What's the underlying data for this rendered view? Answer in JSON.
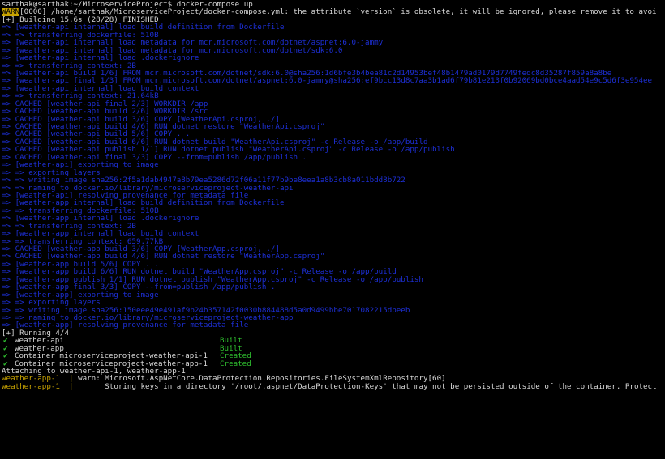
{
  "terminal": {
    "prompt": "sarthak@sarthak:~/MicroserviceProject$ docker-compose up",
    "warn": {
      "tag": "WARN",
      "text": "[0000] /home/sarthak/MicroserviceProject/docker-compose.yml: the attribute `version` is obsolete, it will be ignored, please remove it to avoi"
    },
    "building": "[+] Building 15.6s (28/28) FINISHED",
    "build_lines": [
      "=> [weather-api internal] load build definition from Dockerfile",
      "=> => transferring dockerfile: 510B",
      "=> [weather-api internal] load metadata for mcr.microsoft.com/dotnet/aspnet:6.0-jammy",
      "=> [weather-api internal] load metadata for mcr.microsoft.com/dotnet/sdk:6.0",
      "=> [weather-api internal] load .dockerignore",
      "=> => transferring context: 2B",
      "=> [weather-api build 1/6] FROM mcr.microsoft.com/dotnet/sdk:6.0@sha256:1d6bfe3b4bea81c2d14953bef48b1479ad0179d7749fedc8d35287f859a8a8be",
      "=> [weather-api final 1/3] FROM mcr.microsoft.com/dotnet/aspnet:6.0-jammy@sha256:ef9bcc13d8c7aa3b1ad6f79b81e213f0b92069bd0bce4aad54e9c5d6f3e954ee",
      "=> [weather-api internal] load build context",
      "=> => transferring context: 21.64kB",
      "=> CACHED [weather-api final 2/3] WORKDIR /app",
      "=> CACHED [weather-api build 2/6] WORKDIR /src",
      "=> CACHED [weather-api build 3/6] COPY [WeatherApi.csproj, ./]",
      "=> CACHED [weather-api build 4/6] RUN dotnet restore \"WeatherApi.csproj\"",
      "=> CACHED [weather-api build 5/6] COPY . .",
      "=> CACHED [weather-api build 6/6] RUN dotnet build \"WeatherApi.csproj\" -c Release -o /app/build",
      "=> CACHED [weather-api publish 1/1] RUN dotnet publish \"WeatherApi.csproj\" -c Release -o /app/publish",
      "=> CACHED [weather-api final 3/3] COPY --from=publish /app/publish .",
      "=> [weather-api] exporting to image",
      "=> => exporting layers",
      "=> => writing image sha256:2f5a1dab4947a8b79ea5286d72f06a11f77b9be8eea1a8b3cb8a011bdd8b722",
      "=> => naming to docker.io/library/microserviceproject-weather-api",
      "=> [weather-api] resolving provenance for metadata file",
      "=> [weather-app internal] load build definition from Dockerfile",
      "=> => transferring dockerfile: 510B",
      "=> [weather-app internal] load .dockerignore",
      "=> => transferring context: 2B",
      "=> [weather-app internal] load build context",
      "=> => transferring context: 659.77kB",
      "=> CACHED [weather-app build 3/6] COPY [WeatherApp.csproj, ./]",
      "=> CACHED [weather-app build 4/6] RUN dotnet restore \"WeatherApp.csproj\"",
      "=> [weather-app build 5/6] COPY . .",
      "=> [weather-app build 6/6] RUN dotnet build \"WeatherApp.csproj\" -c Release -o /app/build",
      "=> [weather-app publish 1/1] RUN dotnet publish \"WeatherApp.csproj\" -c Release -o /app/publish",
      "=> [weather-app final 3/3] COPY --from=publish /app/publish .",
      "=> [weather-app] exporting to image",
      "=> => exporting layers",
      "=> => writing image sha256:150eee49e491af9b24b357142f0030b884488d5a0d9499bbe7017082215dbeeb",
      "=> => naming to docker.io/library/microserviceproject-weather-app",
      "=> [weather-app] resolving provenance for metadata file"
    ],
    "running": "[+] Running 4/4",
    "services": [
      {
        "check": "✔",
        "name": "weather-api",
        "status": "Built"
      },
      {
        "check": "✔",
        "name": "weather-app",
        "status": "Built"
      },
      {
        "check": "✔",
        "name": "Container microserviceproject-weather-api-1",
        "status": "Created"
      },
      {
        "check": "✔",
        "name": "Container microserviceproject-weather-app-1",
        "status": "Created"
      }
    ],
    "attaching": "Attaching to weather-api-1, weather-app-1",
    "logs": [
      {
        "service": "weather-app-1",
        "sep": "  | ",
        "text": "warn: Microsoft.AspNetCore.DataProtection.Repositories.FileSystemXmlRepository[60]"
      },
      {
        "service": "weather-app-1",
        "sep": "  | ",
        "text": "      Storing keys in a directory '/root/.aspnet/DataProtection-Keys' that may not be persisted outside of the container. Protect"
      }
    ],
    "colors": {
      "background": "#000000",
      "text": "#c8c8c8",
      "build_blue": "#1d2fd6",
      "success_green": "#2fbf2f",
      "warn_yellow": "#c9a400",
      "service_yellow": "#c8a300"
    }
  }
}
